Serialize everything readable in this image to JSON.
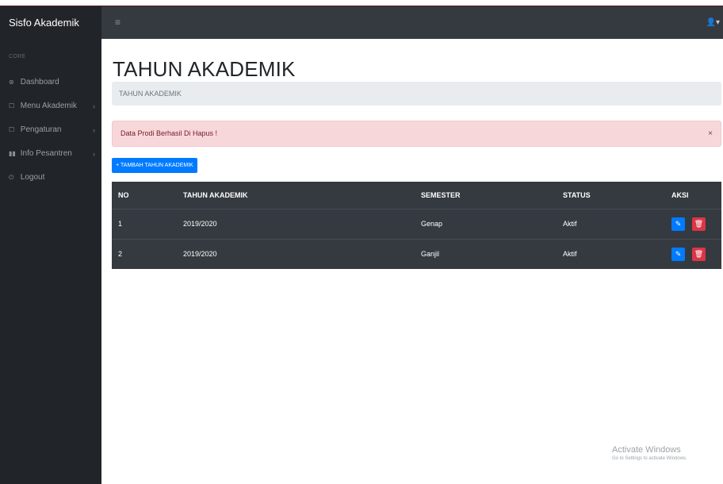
{
  "app": {
    "brand": "Sisfo Akademik",
    "toggle_icon": "≡",
    "user_icon": "👤▾"
  },
  "sidebar": {
    "heading": "CORE",
    "items": [
      {
        "label": "Dashboard",
        "icon": "⊛",
        "chevron": ""
      },
      {
        "label": "Menu Akademik",
        "icon": "☐",
        "chevron": "›"
      },
      {
        "label": "Pengaturan",
        "icon": "☐",
        "chevron": "›"
      },
      {
        "label": "Info Pesantren",
        "icon": "▮▮",
        "chevron": "›"
      },
      {
        "label": "Logout",
        "icon": "⏻",
        "chevron": ""
      }
    ]
  },
  "page": {
    "title": "TAHUN AKADEMIK",
    "breadcrumb": "TAHUN AKADEMIK"
  },
  "alert": {
    "message": "Data Prodi Berhasil Di Hapus !",
    "close": "×"
  },
  "add_button": "+ TAMBAH TAHUN AKADEMIK",
  "table": {
    "headers": [
      "NO",
      "TAHUN AKADEMIK",
      "SEMESTER",
      "STATUS",
      "AKSI"
    ],
    "rows": [
      {
        "no": "1",
        "tahun": "2019/2020",
        "semester": "Genap",
        "status": "Aktif"
      },
      {
        "no": "2",
        "tahun": "2019/2020",
        "semester": "Ganjil",
        "status": "Aktif"
      }
    ],
    "edit_icon": "✎",
    "delete_icon": "🗑"
  },
  "watermark": {
    "line1": "Activate Windows",
    "line2": "Go to Settings to activate Windows."
  },
  "colors": {
    "topbar": "#343a40",
    "sidebar": "#212529",
    "primary": "#007bff",
    "danger": "#dc3545",
    "alert_bg": "#f8d7da"
  }
}
